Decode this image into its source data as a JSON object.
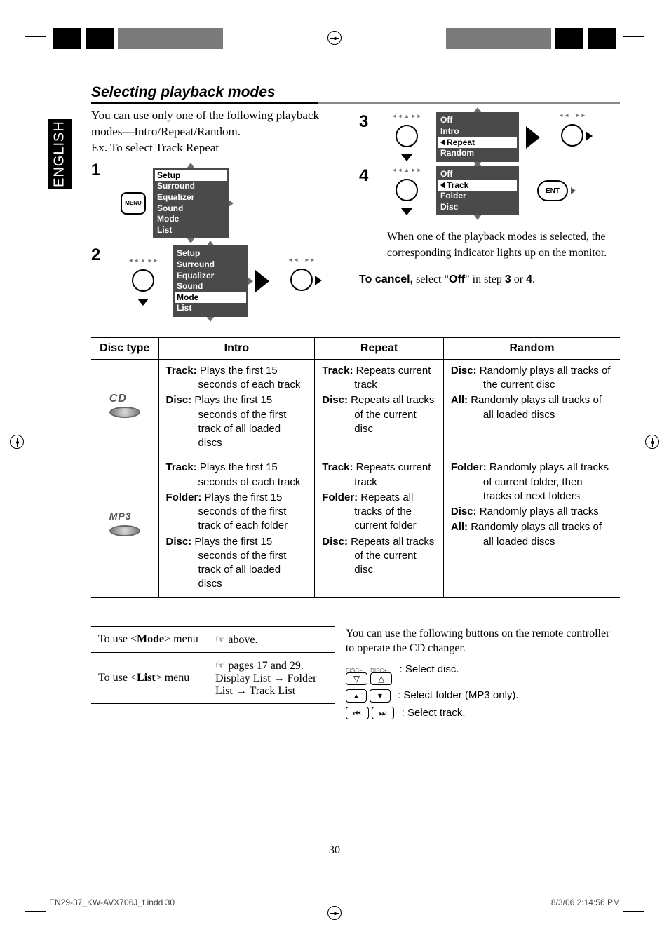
{
  "language_tab": "ENGLISH",
  "section_title": "Selecting playback modes",
  "intro_paragraph": "You can use only one of the following playback modes—Intro/Repeat/Random.",
  "example_line": "Ex. To select Track Repeat",
  "steps": {
    "s1": "1",
    "s2": "2",
    "s3": "3",
    "s4": "4"
  },
  "menu_button": "MENU",
  "ent_button": "ENT",
  "menu1": {
    "items": [
      "Setup",
      "Surround",
      "Equalizer",
      "Sound",
      "Mode",
      "List"
    ],
    "selected": "Setup"
  },
  "menu2": {
    "items": [
      "Setup",
      "Surround",
      "Equalizer",
      "Sound",
      "Mode",
      "List"
    ],
    "selected": "Mode"
  },
  "menu3": {
    "items": [
      "Off",
      "Intro",
      "Repeat",
      "Random"
    ],
    "selected": "Repeat"
  },
  "menu4": {
    "items": [
      "Off",
      "Track",
      "Folder",
      "Disc"
    ],
    "selected": "Track"
  },
  "note": "When one of the playback modes is selected, the corresponding indicator lights up on the monitor.",
  "cancel_prefix": "To cancel,",
  "cancel_mid": " select \"",
  "cancel_off": "Off",
  "cancel_suffix": "\" in step ",
  "cancel_or": " or ",
  "cancel_step_a": "3",
  "cancel_step_b": "4",
  "cancel_end": ".",
  "table": {
    "headers": {
      "disc_type": "Disc type",
      "intro": "Intro",
      "repeat": "Repeat",
      "random": "Random"
    },
    "row1": {
      "label": "CD",
      "intro": [
        {
          "term": "Track:",
          "text": " Plays the first 15 seconds of each track"
        },
        {
          "term": "Disc:",
          "text": " Plays the first 15 seconds of the first track of all loaded discs"
        }
      ],
      "repeat": [
        {
          "term": "Track:",
          "text": " Repeats current track"
        },
        {
          "term": "Disc:",
          "text": " Repeats all tracks of the current disc"
        }
      ],
      "random": [
        {
          "term": "Disc:",
          "text": " Randomly plays all tracks of the current disc"
        },
        {
          "term": "All:",
          "text": " Randomly plays all tracks of all loaded discs"
        }
      ]
    },
    "row2": {
      "label": "MP3",
      "intro": [
        {
          "term": "Track:",
          "text": " Plays the first 15 seconds of each track"
        },
        {
          "term": "Folder:",
          "text": " Plays the first 15 seconds of the first track of each folder"
        },
        {
          "term": "Disc:",
          "text": " Plays the first 15 seconds of the first track of all loaded discs"
        }
      ],
      "repeat": [
        {
          "term": "Track:",
          "text": " Repeats current track"
        },
        {
          "term": "Folder:",
          "text": " Repeats all tracks of the current folder"
        },
        {
          "term": "Disc:",
          "text": " Repeats all tracks of the current disc"
        }
      ],
      "random": [
        {
          "term": "Folder:",
          "text": " Randomly plays all tracks of current folder, then tracks of next folders"
        },
        {
          "term": "Disc:",
          "text": " Randomly plays all tracks"
        },
        {
          "term": "All:",
          "text": " Randomly plays all tracks of all loaded discs"
        }
      ]
    }
  },
  "ref_table": {
    "row1": {
      "left_prefix": "To use <",
      "left_bold": "Mode",
      "left_suffix": "> menu",
      "right": "☞ above."
    },
    "row2": {
      "left_prefix": "To use <",
      "left_bold": "List",
      "left_suffix": "> menu",
      "right_line1": "☞ pages 17 and 29.",
      "right_line2": "Display List → Folder List → Track List"
    }
  },
  "remote_intro": "You can use the following buttons on the remote controller to operate the CD changer.",
  "remote": {
    "disc_minus": "DISC−",
    "disc_plus": "DISC+",
    "line1": ":  Select disc.",
    "line2": " :  Select folder (MP3 only).",
    "line3": " :  Select track."
  },
  "page_number": "30",
  "footer_left": "EN29-37_KW-AVX706J_f.indd   30",
  "footer_right": "8/3/06   2:14:56 PM"
}
